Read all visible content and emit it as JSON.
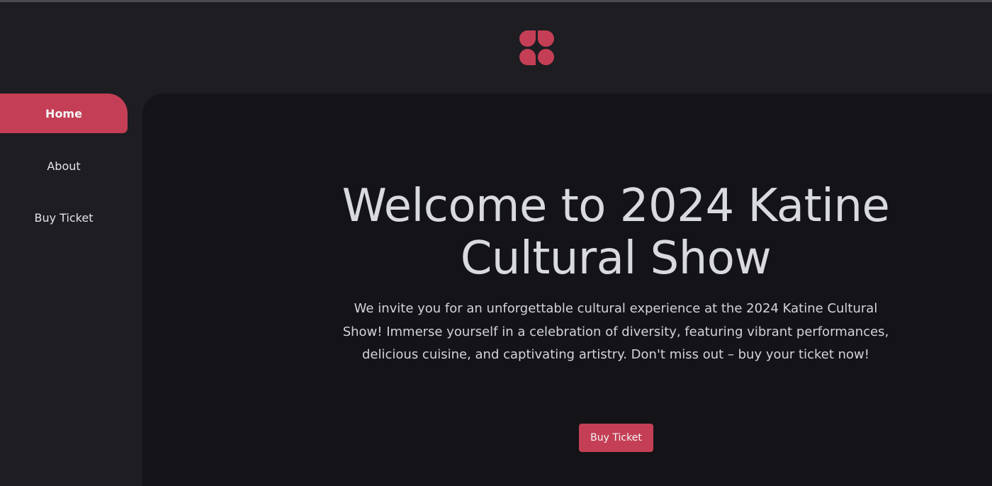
{
  "brand": {
    "logo_icon": "four-petal-logo-icon",
    "accent_color": "#c43f55"
  },
  "sidebar": {
    "items": [
      {
        "label": "Home",
        "active": true
      },
      {
        "label": "About",
        "active": false
      },
      {
        "label": "Buy Ticket",
        "active": false
      }
    ]
  },
  "hero": {
    "title": "Welcome to 2024 Katine Cultural Show",
    "description": "We invite you for an unforgettable cultural experience at the 2024 Katine Cultural Show! Immerse yourself in a celebration of diversity, featuring vibrant performances, delicious cuisine, and captivating artistry. Don't miss out – buy your ticket now!",
    "button_label": "Buy Ticket"
  }
}
